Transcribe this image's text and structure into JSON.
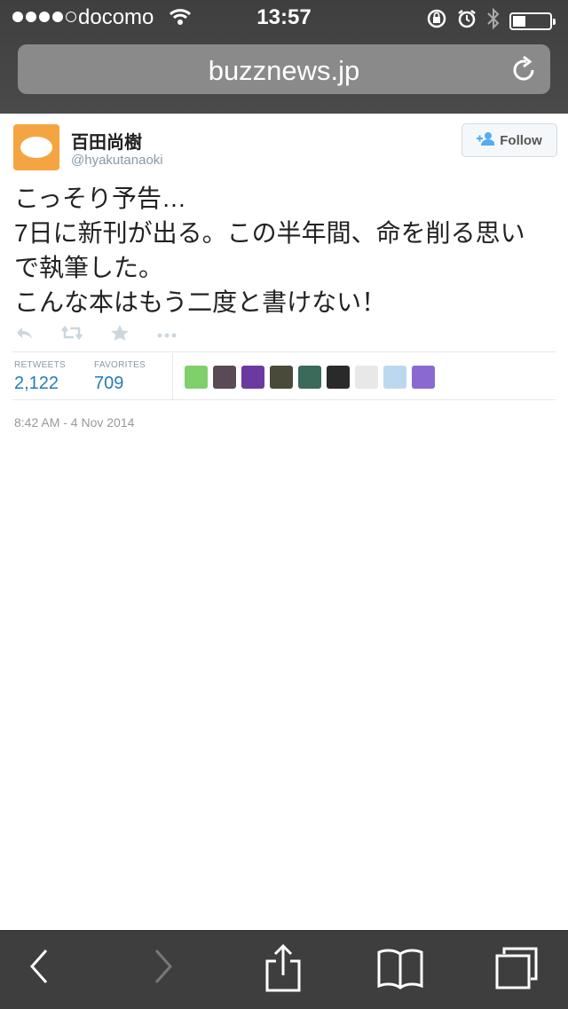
{
  "status": {
    "carrier": "docomo",
    "time": "13:57",
    "signal_bars": 4,
    "signal_total": 5,
    "battery_level": 0.3
  },
  "browser": {
    "url": "buzznews.jp"
  },
  "tweet": {
    "name": "百田尚樹",
    "handle": "@hyakutanaoki",
    "follow_label": "Follow",
    "text": "こっそり予告…\n7日に新刊が出る。この半年間、命を削る思い\nで執筆した。\nこんな本はもう二度と書けない！",
    "retweets_label": "RETWEETS",
    "retweets": "2,122",
    "favorites_label": "FAVORITES",
    "favorites": "709",
    "timestamp": "8:42 AM - 4 Nov 2014",
    "favoriter_colors": [
      "#7fcf6a",
      "#5a4a55",
      "#6a3aa0",
      "#4a4a3a",
      "#3a6a5a",
      "#2a2a2a",
      "#e8e8e8",
      "#bcd8f0",
      "#8a6ad0"
    ]
  },
  "colors": {
    "link": "#2a7bb5",
    "avatar": "#f4a542"
  }
}
